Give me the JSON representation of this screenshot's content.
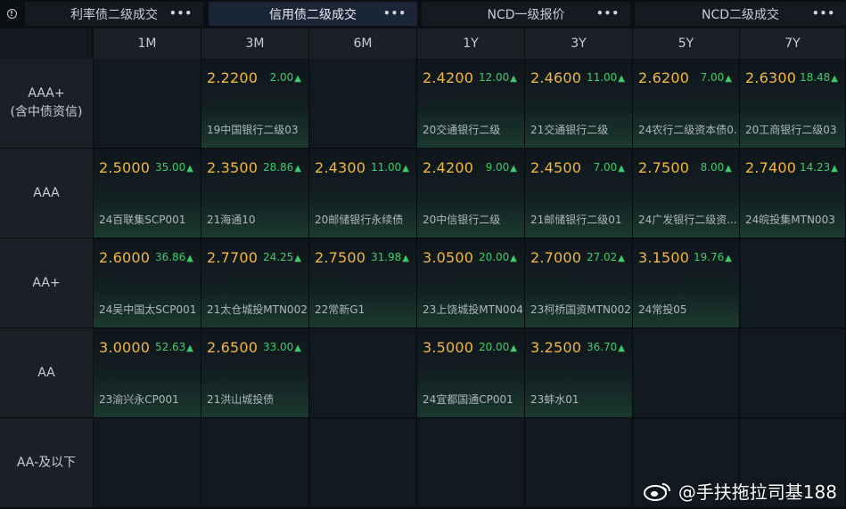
{
  "tabs": [
    {
      "label": "利率债二级成交",
      "active": false
    },
    {
      "label": "信用债二级成交",
      "active": true
    },
    {
      "label": "NCD一级报价",
      "active": false
    },
    {
      "label": "NCD二级成交",
      "active": false
    }
  ],
  "more_label": "•••",
  "info_label": "!",
  "columns": [
    "1M",
    "3M",
    "6M",
    "1Y",
    "3Y",
    "5Y",
    "7Y"
  ],
  "rows": [
    {
      "label": "AAA+",
      "sublabel": "(含中债资信)",
      "cells": [
        null,
        {
          "yield": "2.2200",
          "change": "2.00",
          "bond": "19中国银行二级03"
        },
        null,
        {
          "yield": "2.4200",
          "change": "12.00",
          "bond": "20交通银行二级"
        },
        {
          "yield": "2.4600",
          "change": "11.00",
          "bond": "21交通银行二级"
        },
        {
          "yield": "2.6200",
          "change": "7.00",
          "bond": "24农行二级资本债0..."
        },
        {
          "yield": "2.6300",
          "change": "18.48",
          "bond": "20工商银行二级03"
        }
      ]
    },
    {
      "label": "AAA",
      "sublabel": "",
      "cells": [
        {
          "yield": "2.5000",
          "change": "35.00",
          "bond": "24百联集SCP001"
        },
        {
          "yield": "2.3500",
          "change": "28.86",
          "bond": "21海通10"
        },
        {
          "yield": "2.4300",
          "change": "11.00",
          "bond": "20邮储银行永续债"
        },
        {
          "yield": "2.4200",
          "change": "9.00",
          "bond": "20中信银行二级"
        },
        {
          "yield": "2.4500",
          "change": "7.00",
          "bond": "21邮储银行二级01"
        },
        {
          "yield": "2.7500",
          "change": "8.00",
          "bond": "24广发银行二级资..."
        },
        {
          "yield": "2.7400",
          "change": "14.23",
          "bond": "24皖投集MTN003"
        }
      ]
    },
    {
      "label": "AA+",
      "sublabel": "",
      "cells": [
        {
          "yield": "2.6000",
          "change": "36.86",
          "bond": "24吴中国太SCP001"
        },
        {
          "yield": "2.7700",
          "change": "24.25",
          "bond": "21太仓城投MTN002"
        },
        {
          "yield": "2.7500",
          "change": "31.98",
          "bond": "22常新G1"
        },
        {
          "yield": "3.0500",
          "change": "20.00",
          "bond": "23上饶城投MTN004"
        },
        {
          "yield": "2.7000",
          "change": "27.02",
          "bond": "23柯桥国资MTN002"
        },
        {
          "yield": "3.1500",
          "change": "19.76",
          "bond": "24常投05"
        },
        null
      ]
    },
    {
      "label": "AA",
      "sublabel": "",
      "cells": [
        {
          "yield": "3.0000",
          "change": "52.63",
          "bond": "23渝兴永CP001"
        },
        {
          "yield": "2.6500",
          "change": "33.00",
          "bond": "21洪山城投债"
        },
        null,
        {
          "yield": "3.5000",
          "change": "20.00",
          "bond": "24宜都国通CP001"
        },
        {
          "yield": "3.2500",
          "change": "36.70",
          "bond": "23蚌水01"
        },
        null,
        null
      ]
    },
    {
      "label": "AA-及以下",
      "sublabel": "",
      "cells": [
        null,
        null,
        null,
        null,
        null,
        null,
        null
      ]
    }
  ],
  "arrow_glyph": "▲",
  "watermark": "@手扶拖拉司基188",
  "colors": {
    "yield": "#f4b73f",
    "change_up": "#3ecc6a",
    "tab_active": "#1a2637"
  }
}
